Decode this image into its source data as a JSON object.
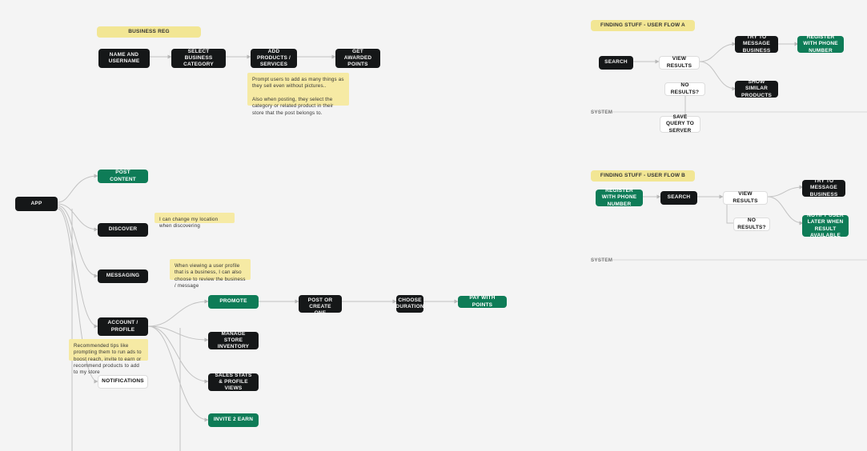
{
  "titles": {
    "business_reg": "BUSINESS REG",
    "flow_a": "FINDING STUFF - USER FLOW A",
    "flow_b": "FINDING STUFF - USER FLOW B"
  },
  "system_label": "SYSTEM",
  "nodes": {
    "app": "APP",
    "post_content": "POST CONTENT",
    "discover": "DISCOVER",
    "messaging": "MESSAGING",
    "account_profile": "ACCOUNT / PROFILE",
    "notifications": "NOTIFICATIONS",
    "name_username": "NAME AND USERNAME",
    "select_business_category": "SELECT BUSINESS CATEGORY",
    "add_products_services": "ADD PRODUCTS / SERVICES",
    "get_awarded_points": "GET AWARDED POINTS",
    "promote": "PROMOTE",
    "manage_store_inventory": "MANAGE STORE INVENTORY",
    "sales_stats_views": "SALES STATS & PROFILE VIEWS",
    "invite_earn": "INVITE 2 EARN",
    "select_post_create": "SELECT A POST OR CREATE ONE",
    "choose_duration": "CHOOSE DURATION",
    "pay_with_points": "PAY WITH POINTS",
    "search_a": "SEARCH",
    "view_results_a": "VIEW RESULTS",
    "no_results_a": "NO RESULTS?",
    "try_message_business_a": "TRY TO MESSAGE BUSINESS",
    "register_phone_a": "REGISTER WITH PHONE NUMBER",
    "show_similar_products": "SHOW SIMILAR PRODUCTS",
    "save_query_server": "SAVE QUERY TO SERVER",
    "register_phone_b": "REGISTER WITH PHONE NUMBER",
    "search_b": "SEARCH",
    "view_results_b": "VIEW RESULTS",
    "no_results_b": "NO RESULTS?",
    "try_message_business_b": "TRY TO MESSAGE BUSINESS",
    "notify_user_later": "NOTIFY USER LATER WHEN RESULT AVAILABLE"
  },
  "stickies": {
    "add_products_note": "Prompt users to add as many things as they sell even without pictures..\n\nAlso when posting, they select the category or related product in their store that the post belongs to.",
    "discover_note": "I can change my location when discovering",
    "messaging_note": "When viewing a user profile that is a business, I can also choose to review the business / message",
    "account_tips_note": "Recommended tips like prompting them to run ads to boost reach, invite to earn or recommend products to add to my store"
  }
}
